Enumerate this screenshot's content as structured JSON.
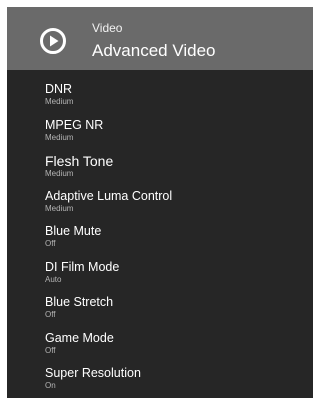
{
  "header": {
    "category": "Video",
    "title": "Advanced Video",
    "icon": "play-circle-icon"
  },
  "colors": {
    "header_bg": "#6a6a6a",
    "panel_bg": "#262626",
    "label_text": "#ffffff",
    "value_text": "#b4b4b4"
  },
  "menu": {
    "items": [
      {
        "label": "DNR",
        "value": "Medium"
      },
      {
        "label": "MPEG NR",
        "value": "Medium"
      },
      {
        "label": "Flesh Tone",
        "value": "Medium"
      },
      {
        "label": "Adaptive Luma Control",
        "value": "Medium"
      },
      {
        "label": "Blue Mute",
        "value": "Off"
      },
      {
        "label": "DI Film Mode",
        "value": "Auto"
      },
      {
        "label": "Blue Stretch",
        "value": "Off"
      },
      {
        "label": "Game Mode",
        "value": "Off"
      },
      {
        "label": "Super Resolution",
        "value": "On"
      }
    ]
  }
}
